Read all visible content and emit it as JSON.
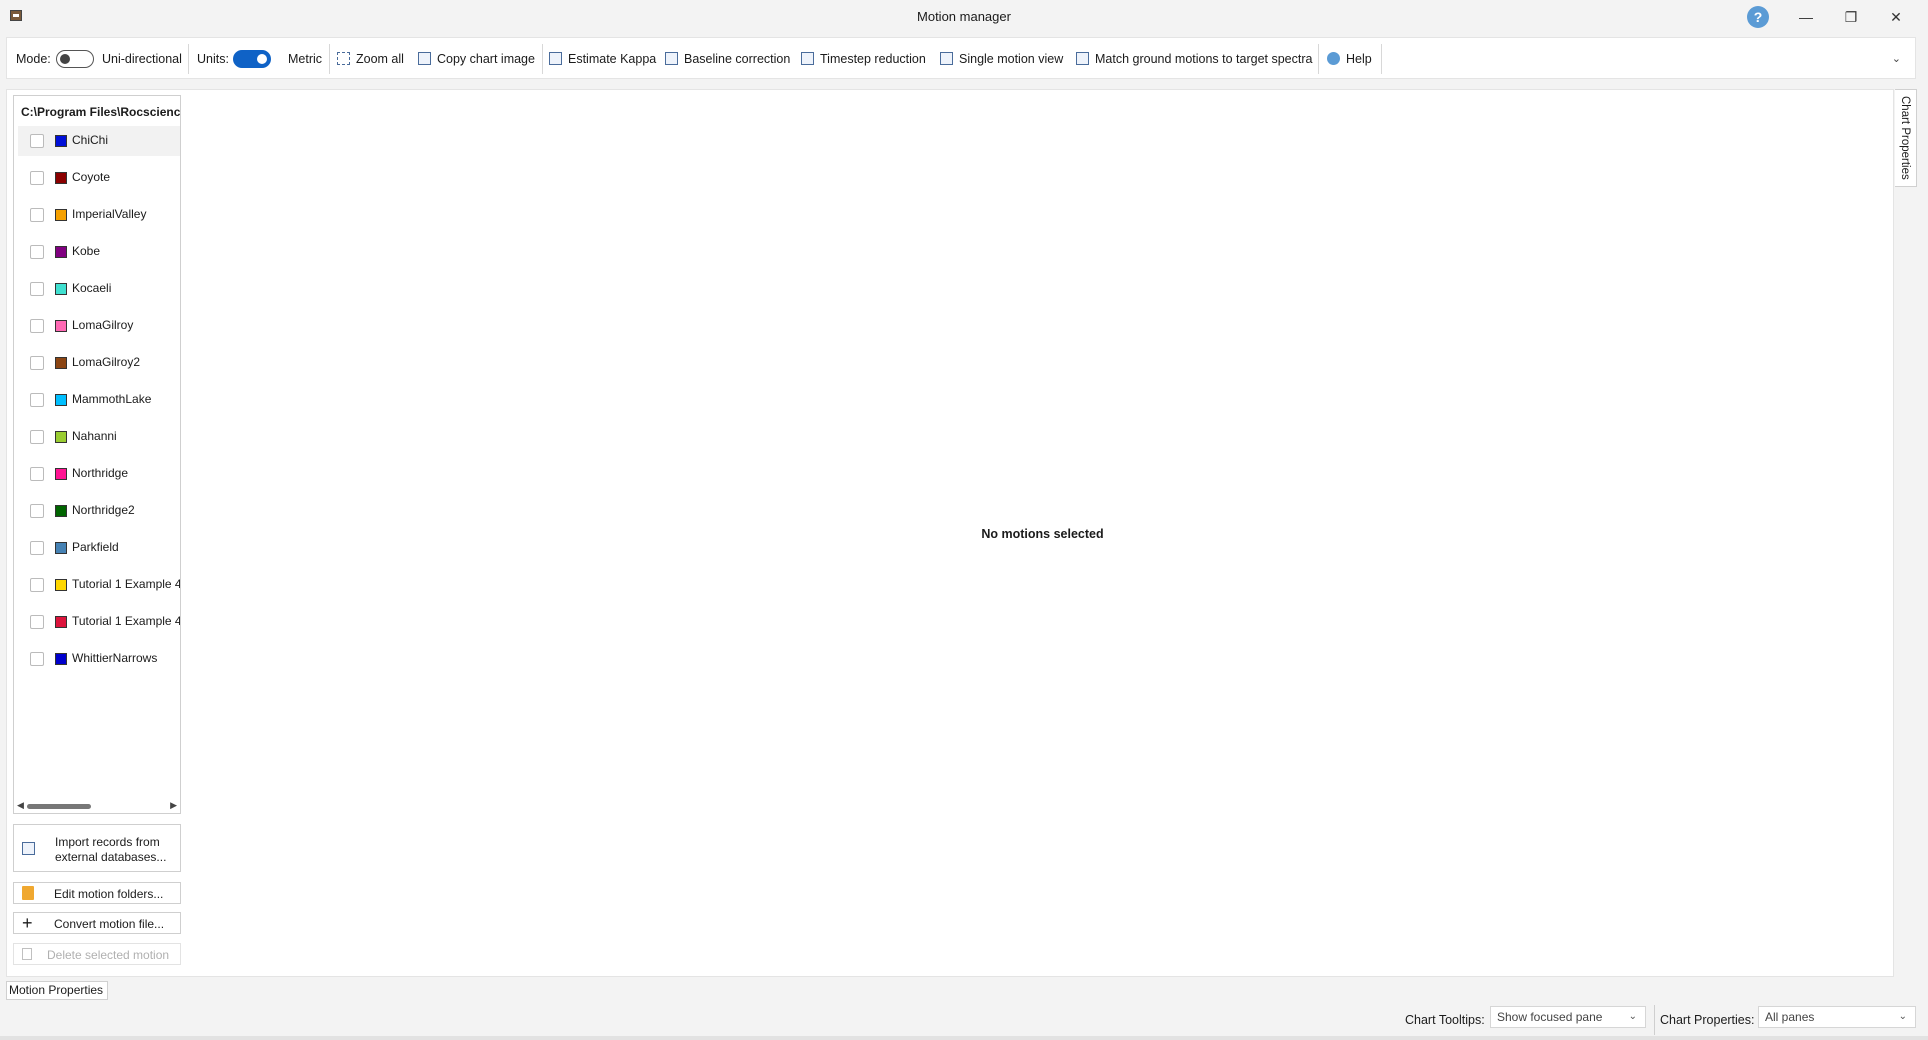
{
  "window": {
    "title": "Motion manager"
  },
  "toolbar": {
    "mode_label": "Mode:",
    "mode_value": "Uni-directional",
    "units_label": "Units:",
    "units_value": "Metric",
    "zoom_all": "Zoom all",
    "copy_chart": "Copy chart image",
    "estimate_kappa": "Estimate Kappa",
    "baseline": "Baseline correction",
    "timestep": "Timestep reduction",
    "single_view": "Single motion view",
    "match_spectra": "Match ground motions to target spectra",
    "help": "Help"
  },
  "motions": {
    "folder": "C:\\Program Files\\Rocscience",
    "items": [
      {
        "name": "ChiChi",
        "color": "#0010d8"
      },
      {
        "name": "Coyote",
        "color": "#8b0000"
      },
      {
        "name": "ImperialValley",
        "color": "#f5a000"
      },
      {
        "name": "Kobe",
        "color": "#800080"
      },
      {
        "name": "Kocaeli",
        "color": "#40e0d0"
      },
      {
        "name": "LomaGilroy",
        "color": "#ff69b4"
      },
      {
        "name": "LomaGilroy2",
        "color": "#8b4513"
      },
      {
        "name": "MammothLake",
        "color": "#00bfff"
      },
      {
        "name": "Nahanni",
        "color": "#9acd32"
      },
      {
        "name": "Northridge",
        "color": "#ff1493"
      },
      {
        "name": "Northridge2",
        "color": "#006400"
      },
      {
        "name": "Parkfield",
        "color": "#4682b4"
      },
      {
        "name": "Tutorial 1 Example 4",
        "color": "#ffd700"
      },
      {
        "name": "Tutorial 1 Example 4",
        "color": "#dc143c"
      },
      {
        "name": "WhittierNarrows",
        "color": "#0000cd"
      }
    ]
  },
  "sidebar_actions": {
    "import_line1": "Import records from",
    "import_line2": "external databases...",
    "edit_folders": "Edit motion folders...",
    "convert": "Convert motion file...",
    "delete": "Delete selected motion"
  },
  "chart": {
    "empty_message": "No motions selected"
  },
  "panels": {
    "chart_properties_tab": "Chart Properties",
    "motion_properties_tab": "Motion Properties"
  },
  "statusbar": {
    "tooltips_label": "Chart Tooltips:",
    "tooltips_value": "Show focused pane",
    "props_label": "Chart Properties:",
    "props_value": "All panes"
  }
}
